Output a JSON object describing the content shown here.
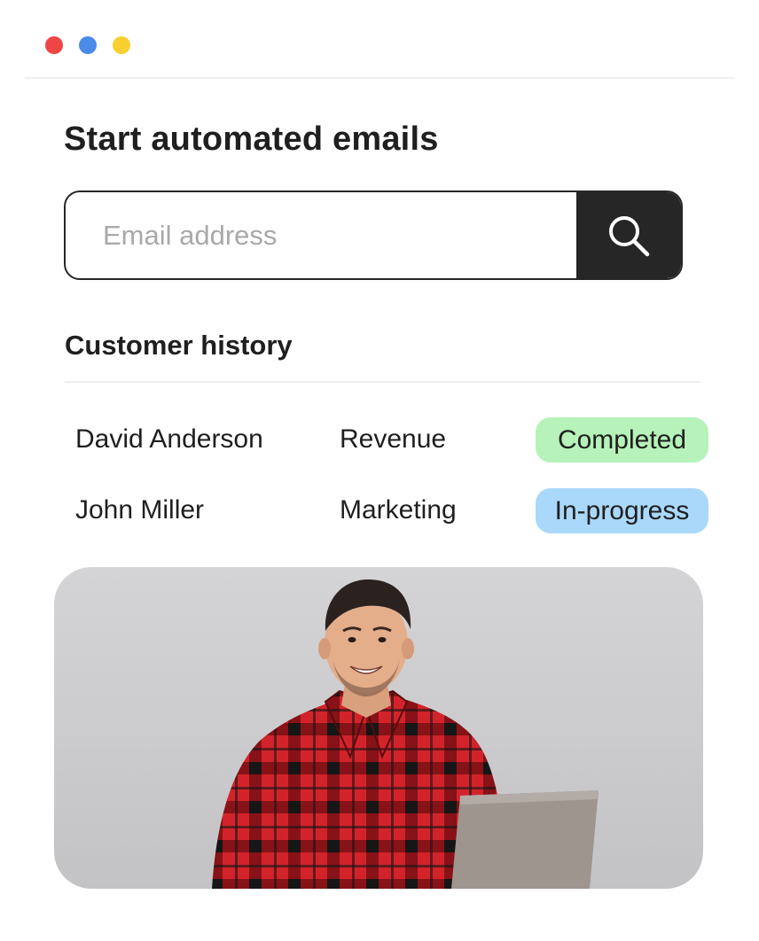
{
  "window": {
    "dots": [
      "#f04545",
      "#4a8bea",
      "#f7cf31"
    ]
  },
  "header": {
    "title": "Start automated emails"
  },
  "search": {
    "placeholder": "Email address",
    "button_icon": "search-icon"
  },
  "history": {
    "title": "Customer history",
    "rows": [
      {
        "name": "David Anderson",
        "department": "Revenue",
        "status": "Completed",
        "status_color": "#b6f2b9"
      },
      {
        "name": "John Miller",
        "department": "Marketing",
        "status": "In-progress",
        "status_color": "#a9d8fb"
      }
    ]
  },
  "photo": {
    "subject": "smiling-man-with-laptop"
  }
}
